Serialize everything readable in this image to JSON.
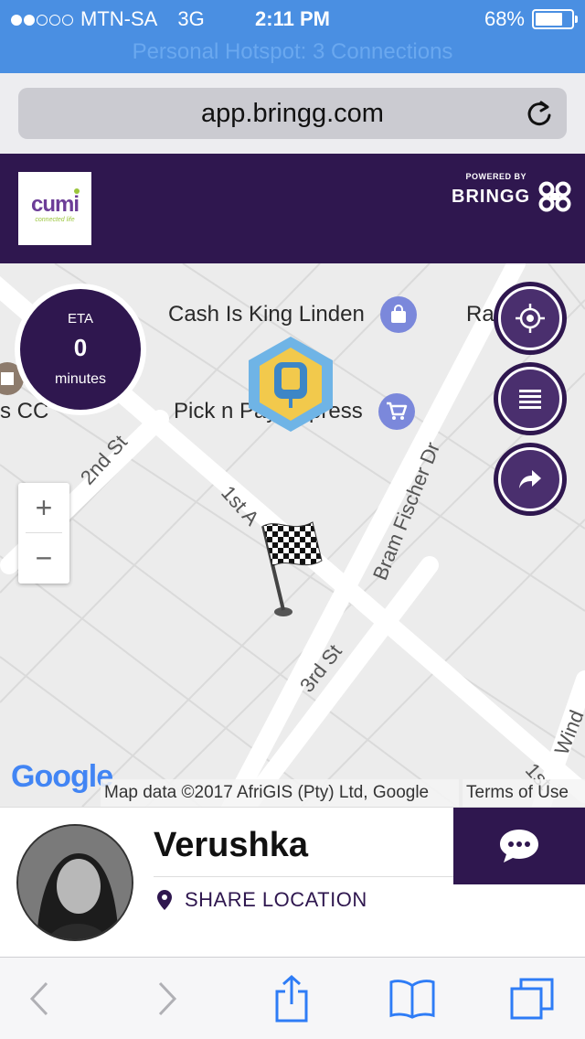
{
  "status_bar": {
    "carrier": "MTN-SA",
    "network": "3G",
    "time": "2:11 PM",
    "battery": "68%",
    "battery_level": 0.68,
    "hotspot": "Personal Hotspot: 3 Connections"
  },
  "browser": {
    "url": "app.bringg.com"
  },
  "header": {
    "logo_word": "cumi",
    "logo_tagline": "connected life",
    "powered_by": "POWERED BY",
    "brand": "BRINGG"
  },
  "map": {
    "pois": [
      "Cash Is King Linden",
      "Pick n Pay Express",
      "Ra",
      "s CC"
    ],
    "streets": [
      "2nd St",
      "1st A",
      "Bram Fischer Dr",
      "3rd St",
      "1st",
      "Wind"
    ],
    "eta": {
      "label": "ETA",
      "value": "0",
      "unit": "minutes"
    },
    "zoom_in": "+",
    "zoom_out": "−",
    "google_logo": "Google",
    "attribution": "Map data ©2017 AfriGIS (Pty) Ltd, Google",
    "terms": "Terms of Use",
    "controls": [
      "locate-icon",
      "list-icon",
      "share-arrow-icon"
    ]
  },
  "driver": {
    "name": "Verushka",
    "share_location": "SHARE LOCATION"
  },
  "colors": {
    "brand_purple": "#2f174f",
    "status_blue": "#4a8fe2",
    "cumi_purple": "#6c3d97",
    "cumi_green": "#9bc53d"
  }
}
